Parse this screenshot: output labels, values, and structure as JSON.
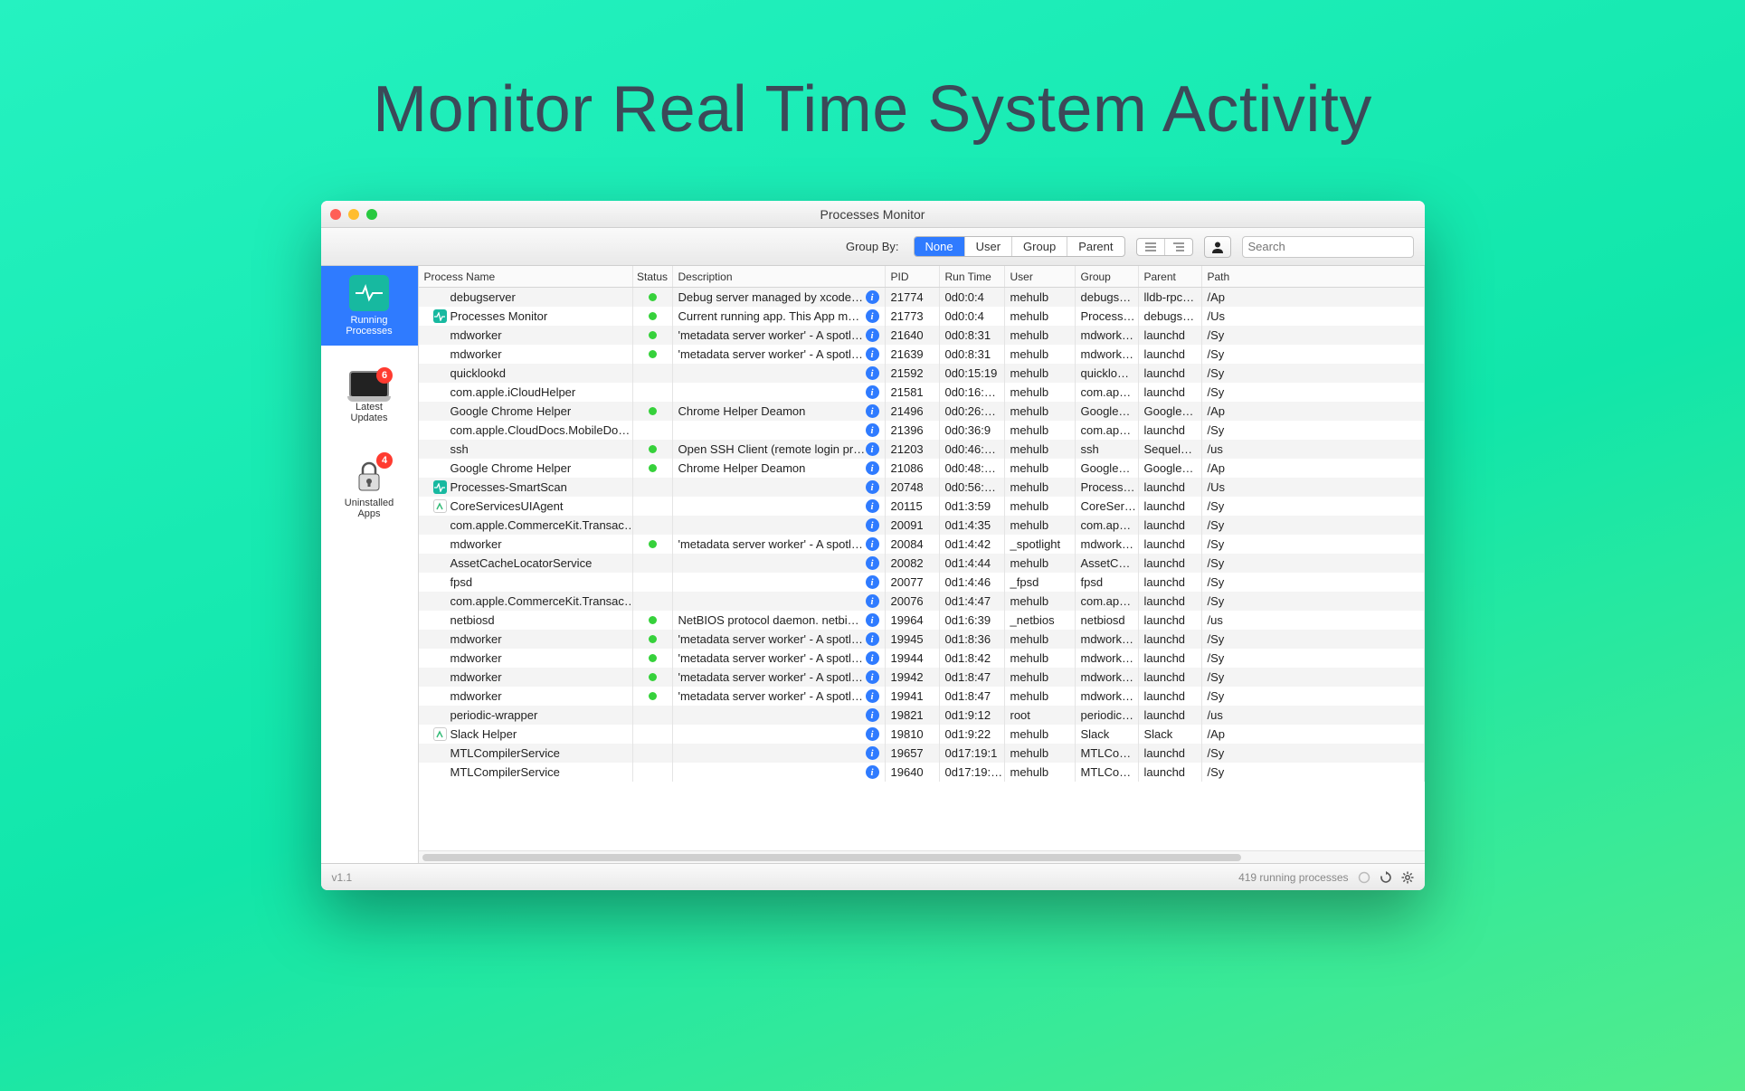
{
  "hero": "Monitor Real Time System Activity",
  "window": {
    "title": "Processes Monitor",
    "version": "v1.1",
    "status_text": "419 running processes"
  },
  "toolbar": {
    "group_by_label": "Group By:",
    "options": [
      "None",
      "User",
      "Group",
      "Parent"
    ],
    "active": "None",
    "search_placeholder": "Search"
  },
  "sidebar": {
    "items": [
      {
        "id": "running",
        "label_line1": "Running",
        "label_line2": "Processes",
        "active": true
      },
      {
        "id": "updates",
        "label_line1": "Latest",
        "label_line2": "Updates",
        "badge": "6"
      },
      {
        "id": "uninstalled",
        "label_line1": "Uninstalled",
        "label_line2": "Apps",
        "badge": "4"
      }
    ]
  },
  "columns": [
    "Process Name",
    "Status",
    "Description",
    "PID",
    "Run Time",
    "User",
    "Group",
    "Parent",
    "Path"
  ],
  "rows": [
    {
      "icon": "",
      "name": "debugserver",
      "status": true,
      "desc": "Debug server managed by xcode f…",
      "pid": "21774",
      "runtime": "0d0:0:4",
      "user": "mehulb",
      "group": "debugs…",
      "parent": "lldb-rpc…",
      "path": "/Ap"
    },
    {
      "icon": "pulse",
      "name": "Processes Monitor",
      "status": true,
      "desc": "Current running app. This App mo…",
      "pid": "21773",
      "runtime": "0d0:0:4",
      "user": "mehulb",
      "group": "Process…",
      "parent": "debugs…",
      "path": "/Us"
    },
    {
      "icon": "",
      "name": "mdworker",
      "status": true,
      "desc": "'metadata server worker' - A spotli…",
      "pid": "21640",
      "runtime": "0d0:8:31",
      "user": "mehulb",
      "group": "mdwork…",
      "parent": "launchd",
      "path": "/Sy"
    },
    {
      "icon": "",
      "name": "mdworker",
      "status": true,
      "desc": "'metadata server worker' - A spotli…",
      "pid": "21639",
      "runtime": "0d0:8:31",
      "user": "mehulb",
      "group": "mdwork…",
      "parent": "launchd",
      "path": "/Sy"
    },
    {
      "icon": "",
      "name": "quicklookd",
      "status": false,
      "desc": "",
      "pid": "21592",
      "runtime": "0d0:15:19",
      "user": "mehulb",
      "group": "quicklo…",
      "parent": "launchd",
      "path": "/Sy"
    },
    {
      "icon": "",
      "name": "com.apple.iCloudHelper",
      "status": false,
      "desc": "",
      "pid": "21581",
      "runtime": "0d0:16:…",
      "user": "mehulb",
      "group": "com.ap…",
      "parent": "launchd",
      "path": "/Sy"
    },
    {
      "icon": "",
      "name": "Google Chrome Helper",
      "status": true,
      "desc": "Chrome Helper Deamon",
      "pid": "21496",
      "runtime": "0d0:26:…",
      "user": "mehulb",
      "group": "Google…",
      "parent": "Google…",
      "path": "/Ap"
    },
    {
      "icon": "",
      "name": "com.apple.CloudDocs.MobileDo…",
      "status": false,
      "desc": "",
      "pid": "21396",
      "runtime": "0d0:36:9",
      "user": "mehulb",
      "group": "com.ap…",
      "parent": "launchd",
      "path": "/Sy"
    },
    {
      "icon": "",
      "name": "ssh",
      "status": true,
      "desc": "Open SSH Client (remote login pr…",
      "pid": "21203",
      "runtime": "0d0:46:…",
      "user": "mehulb",
      "group": "ssh",
      "parent": "Sequel…",
      "path": "/us"
    },
    {
      "icon": "",
      "name": "Google Chrome Helper",
      "status": true,
      "desc": "Chrome Helper Deamon",
      "pid": "21086",
      "runtime": "0d0:48:…",
      "user": "mehulb",
      "group": "Google…",
      "parent": "Google…",
      "path": "/Ap"
    },
    {
      "icon": "pulse",
      "name": "Processes-SmartScan",
      "status": false,
      "desc": "",
      "pid": "20748",
      "runtime": "0d0:56:…",
      "user": "mehulb",
      "group": "Process…",
      "parent": "launchd",
      "path": "/Us"
    },
    {
      "icon": "app",
      "name": "CoreServicesUIAgent",
      "status": false,
      "desc": "",
      "pid": "20115",
      "runtime": "0d1:3:59",
      "user": "mehulb",
      "group": "CoreSer…",
      "parent": "launchd",
      "path": "/Sy"
    },
    {
      "icon": "",
      "name": "com.apple.CommerceKit.Transac…",
      "status": false,
      "desc": "",
      "pid": "20091",
      "runtime": "0d1:4:35",
      "user": "mehulb",
      "group": "com.ap…",
      "parent": "launchd",
      "path": "/Sy"
    },
    {
      "icon": "",
      "name": "mdworker",
      "status": true,
      "desc": "'metadata server worker' - A spotli…",
      "pid": "20084",
      "runtime": "0d1:4:42",
      "user": "_spotlight",
      "group": "mdwork…",
      "parent": "launchd",
      "path": "/Sy"
    },
    {
      "icon": "",
      "name": "AssetCacheLocatorService",
      "status": false,
      "desc": "",
      "pid": "20082",
      "runtime": "0d1:4:44",
      "user": "mehulb",
      "group": "AssetC…",
      "parent": "launchd",
      "path": "/Sy"
    },
    {
      "icon": "",
      "name": "fpsd",
      "status": false,
      "desc": "",
      "pid": "20077",
      "runtime": "0d1:4:46",
      "user": "_fpsd",
      "group": "fpsd",
      "parent": "launchd",
      "path": "/Sy"
    },
    {
      "icon": "",
      "name": "com.apple.CommerceKit.Transac…",
      "status": false,
      "desc": "",
      "pid": "20076",
      "runtime": "0d1:4:47",
      "user": "mehulb",
      "group": "com.ap…",
      "parent": "launchd",
      "path": "/Sy"
    },
    {
      "icon": "",
      "name": "netbiosd",
      "status": true,
      "desc": "NetBIOS protocol daemon. netbio…",
      "pid": "19964",
      "runtime": "0d1:6:39",
      "user": "_netbios",
      "group": "netbiosd",
      "parent": "launchd",
      "path": "/us"
    },
    {
      "icon": "",
      "name": "mdworker",
      "status": true,
      "desc": "'metadata server worker' - A spotli…",
      "pid": "19945",
      "runtime": "0d1:8:36",
      "user": "mehulb",
      "group": "mdwork…",
      "parent": "launchd",
      "path": "/Sy"
    },
    {
      "icon": "",
      "name": "mdworker",
      "status": true,
      "desc": "'metadata server worker' - A spotli…",
      "pid": "19944",
      "runtime": "0d1:8:42",
      "user": "mehulb",
      "group": "mdwork…",
      "parent": "launchd",
      "path": "/Sy"
    },
    {
      "icon": "",
      "name": "mdworker",
      "status": true,
      "desc": "'metadata server worker' - A spotli…",
      "pid": "19942",
      "runtime": "0d1:8:47",
      "user": "mehulb",
      "group": "mdwork…",
      "parent": "launchd",
      "path": "/Sy"
    },
    {
      "icon": "",
      "name": "mdworker",
      "status": true,
      "desc": "'metadata server worker' - A spotli…",
      "pid": "19941",
      "runtime": "0d1:8:47",
      "user": "mehulb",
      "group": "mdwork…",
      "parent": "launchd",
      "path": "/Sy"
    },
    {
      "icon": "",
      "name": "periodic-wrapper",
      "status": false,
      "desc": "",
      "pid": "19821",
      "runtime": "0d1:9:12",
      "user": "root",
      "group": "periodic…",
      "parent": "launchd",
      "path": "/us"
    },
    {
      "icon": "app",
      "name": "Slack Helper",
      "status": false,
      "desc": "",
      "pid": "19810",
      "runtime": "0d1:9:22",
      "user": "mehulb",
      "group": "Slack",
      "parent": "Slack",
      "path": "/Ap"
    },
    {
      "icon": "",
      "name": "MTLCompilerService",
      "status": false,
      "desc": "",
      "pid": "19657",
      "runtime": "0d17:19:1",
      "user": "mehulb",
      "group": "MTLCo…",
      "parent": "launchd",
      "path": "/Sy"
    },
    {
      "icon": "",
      "name": "MTLCompilerService",
      "status": false,
      "desc": "",
      "pid": "19640",
      "runtime": "0d17:19:…",
      "user": "mehulb",
      "group": "MTLCo…",
      "parent": "launchd",
      "path": "/Sy"
    }
  ]
}
